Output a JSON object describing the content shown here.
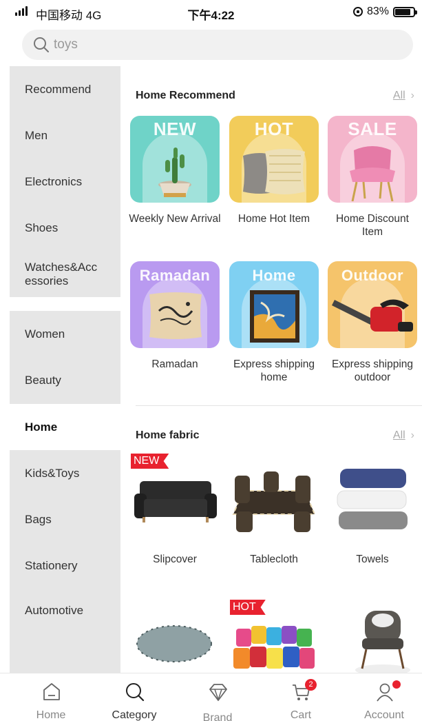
{
  "status_bar": {
    "carrier": "中国移动  4G",
    "time": "下午4:22",
    "battery_text": "83%",
    "battery_level": 0.83
  },
  "search": {
    "placeholder": "toys"
  },
  "sidebar": {
    "items": [
      {
        "label": "Recommend"
      },
      {
        "label": "Men"
      },
      {
        "label": "Electronics"
      },
      {
        "label": "Shoes"
      },
      {
        "label": "Watches&Acc essories"
      },
      {
        "label": "Women"
      },
      {
        "label": "Beauty"
      },
      {
        "label": "Home",
        "active": true
      },
      {
        "label": "Kids&Toys"
      },
      {
        "label": "Bags"
      },
      {
        "label": "Stationery"
      },
      {
        "label": "Automotive"
      }
    ]
  },
  "home_recommend": {
    "title": "Home Recommend",
    "all_label": "All",
    "tiles": [
      {
        "badge": "NEW",
        "caption": "Weekly New Arrival",
        "color": "#6fd3c8",
        "icon": "cactus-plant-image"
      },
      {
        "badge": "HOT",
        "caption": "Home Hot Item",
        "color": "#f2cc5a",
        "icon": "pillows-image"
      },
      {
        "badge": "SALE",
        "caption": "Home Discount Item",
        "color": "#f4b5cb",
        "icon": "pink-chair-image"
      },
      {
        "badge": "Ramadan",
        "caption": "Ramadan",
        "color": "#b99af0",
        "icon": "ramadan-pillow-image"
      },
      {
        "badge": "Home",
        "caption": "Express shipping home",
        "color": "#7fd0f2",
        "icon": "framed-painting-image"
      },
      {
        "badge": "Outdoor",
        "caption": "Express shipping outdoor",
        "color": "#f5c46b",
        "icon": "chainsaw-image"
      }
    ]
  },
  "home_fabric": {
    "title": "Home fabric",
    "all_label": "All",
    "products": [
      {
        "caption": "Slipcover",
        "tag": "NEW",
        "icon": "sofa-image"
      },
      {
        "caption": "Tablecloth",
        "tag": "",
        "icon": "table-set-image"
      },
      {
        "caption": "Towels",
        "tag": "",
        "icon": "towels-image"
      },
      {
        "caption": "",
        "tag": "",
        "icon": "round-cushion-image"
      },
      {
        "caption": "",
        "tag": "HOT",
        "icon": "cushions-image"
      },
      {
        "caption": "",
        "tag": "",
        "icon": "armchair-image"
      }
    ]
  },
  "bottom_nav": {
    "items": [
      {
        "label": "Home",
        "icon": "home-icon"
      },
      {
        "label": "Category",
        "icon": "search-icon",
        "active": true
      },
      {
        "label": "Brand",
        "icon": "diamond-icon"
      },
      {
        "label": "Cart",
        "icon": "cart-icon",
        "badge": "2"
      },
      {
        "label": "Account",
        "icon": "account-icon"
      }
    ]
  },
  "colors": {
    "accent_red": "#e8222f",
    "sidebar_bg": "#e6e6e6"
  }
}
